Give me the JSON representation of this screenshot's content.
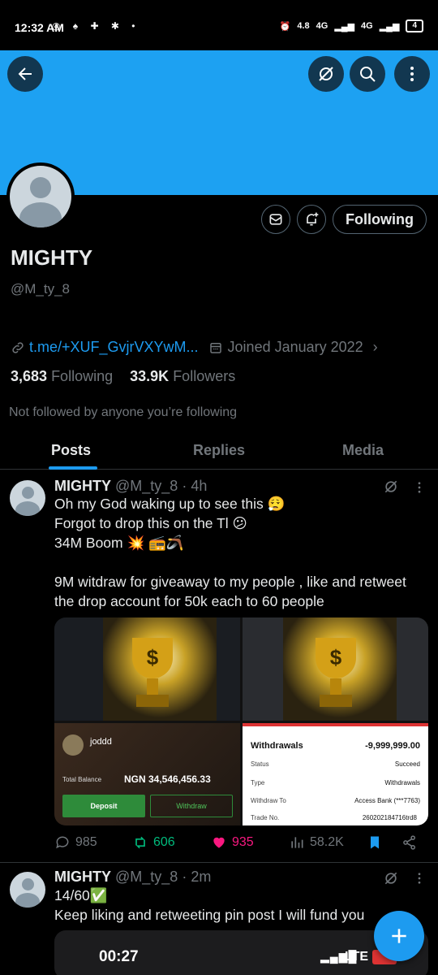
{
  "status_bar": {
    "time": "12:32 AM",
    "net_speed": "4.8",
    "net1": "4G",
    "net2": "4G",
    "battery": "4"
  },
  "profile": {
    "name": "MIGHTY",
    "handle": "@M_ty_8",
    "link": "t.me/+XUF_GvjrVXYwM...",
    "joined": "Joined January 2022",
    "following_count": "3,683",
    "following_label": "Following",
    "followers_count": "33.9K",
    "followers_label": "Followers",
    "not_followed": "Not followed by anyone you’re following",
    "follow_button": "Following"
  },
  "tabs": [
    {
      "label": "Posts",
      "active": true
    },
    {
      "label": "Replies",
      "active": false
    },
    {
      "label": "Media",
      "active": false
    }
  ],
  "post1": {
    "name": "MIGHTY",
    "handle": "@M_ty_8",
    "time": "· 4h",
    "lines": [
      "Oh my God waking up to see this 😮‍💨",
      "Forgot to drop this on the Tl 😕",
      "34M Boom 💥 📻🪃",
      "",
      "9M witdraw for giveaway to my people , like and retweet the drop account for 50k each to 60 people"
    ],
    "replies": "985",
    "retweets": "606",
    "likes": "935",
    "views": "58.2K",
    "media": {
      "balance_label": "Total Balance",
      "balance": "NGN 34,546,456.33",
      "deposit": "Deposit",
      "withdraw": "Withdraw",
      "user": "joddd",
      "withdrawals_title": "Withdrawals",
      "withdrawals_amount": "-9,999,999.00",
      "rows": [
        {
          "k": "Status",
          "v": "Succeed"
        },
        {
          "k": "Type",
          "v": "Withdrawals"
        },
        {
          "k": "Withdraw To",
          "v": "Access Bank (***7763)"
        },
        {
          "k": "Trade No.",
          "v": "260202184716trd8"
        }
      ]
    }
  },
  "post2": {
    "name": "MIGHTY",
    "handle": "@M_ty_8",
    "time": "· 2m",
    "lines": [
      "14/60✅",
      "Keep liking and retweeting pin post I will fund you"
    ],
    "embed_time": "00:27",
    "embed_net": "LTE"
  },
  "colors": {
    "banner": "#1da1f2",
    "accent": "#1d9bf0",
    "like": "#f91880",
    "retweet": "#00ba7c"
  }
}
